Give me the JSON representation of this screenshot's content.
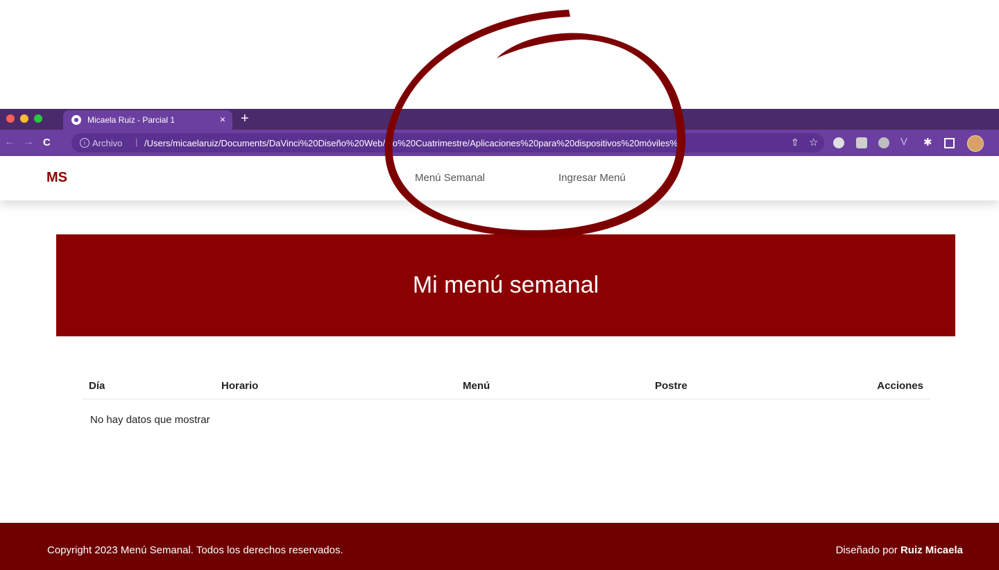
{
  "browser": {
    "tab": {
      "title": "Micaela Ruiz - Parcial 1",
      "close": "×"
    },
    "new_tab": "+",
    "nav": {
      "back": "←",
      "forward": "→",
      "reload": "C"
    },
    "omnibox": {
      "info": "i",
      "scheme_label": "Archivo",
      "separator": "|",
      "url": "/Users/micaelaruiz/Documents/DaVinci%20Diseño%20Web/5to%20Cuatrimestre/Aplicaciones%20para%20dispositivos%20móviles%..."
    },
    "icons": {
      "share": "⇧",
      "bookmark": "☆",
      "ext_v": "V",
      "puzzle": "✱"
    }
  },
  "navbar": {
    "brand": "MS",
    "links": [
      "Menú Semanal",
      "Ingresar Menú"
    ]
  },
  "hero": {
    "title": "Mi menú semanal"
  },
  "table": {
    "headers": [
      "Día",
      "Horario",
      "Menú",
      "Postre",
      "Acciones"
    ],
    "empty_message": "No hay datos que mostrar"
  },
  "footer": {
    "copyright": "Copyright 2023 Menú Semanal. Todos los derechos reservados.",
    "designed_by_prefix": "Diseñado por",
    "designer": "Ruiz Micaela"
  },
  "colors": {
    "brand": "#8b0000",
    "footer": "#6e0000",
    "browser_tabbar": "#4a2a6a",
    "browser_toolbar": "#6b3fa0",
    "annotation_stroke": "#7d0000"
  }
}
